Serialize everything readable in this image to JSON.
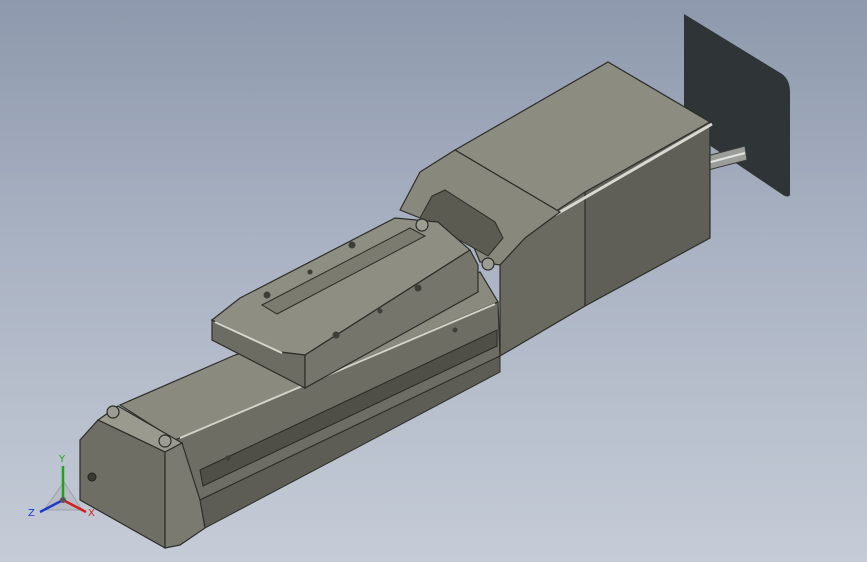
{
  "viewport": {
    "background_top": "#8e99ad",
    "background_bottom": "#c5ccd7",
    "model": {
      "body_color": "#78786d",
      "body_dark": "#55554c",
      "body_light": "#a6a698",
      "motor_color": "#7d7d73",
      "shadow_color": "#2f3437"
    }
  },
  "triad": {
    "x_label": "X",
    "y_label": "Y",
    "z_label": "Z",
    "x_color": "#d11f1f",
    "y_color": "#1ea11e",
    "z_color": "#1f39c9"
  }
}
